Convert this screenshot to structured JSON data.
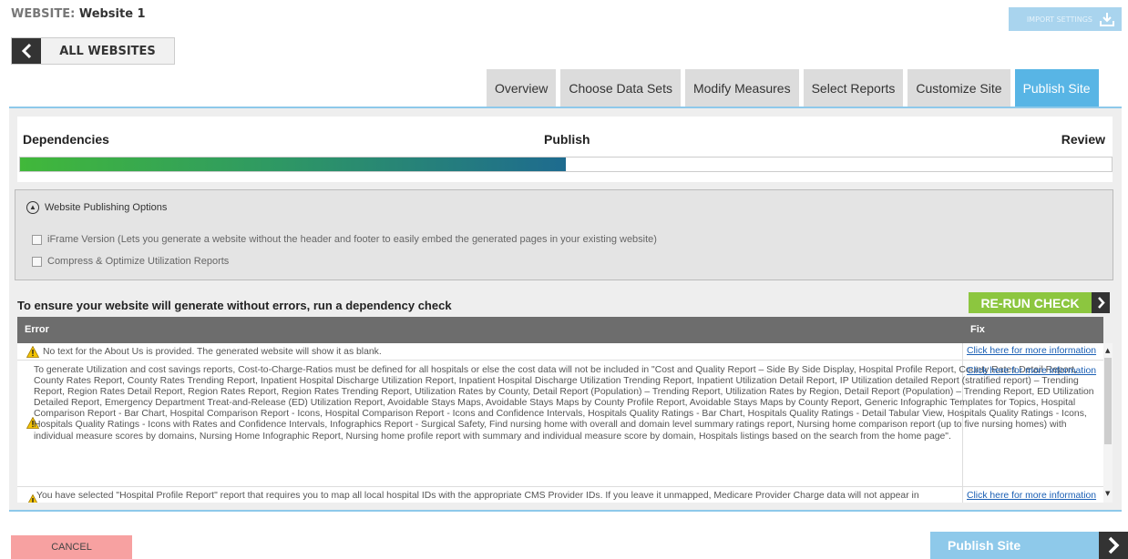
{
  "header": {
    "website_label": "WEBSITE:",
    "website_name": "Website 1",
    "import_label": "IMPORT SETTINGS",
    "back_label": "ALL WEBSITES"
  },
  "tabs": [
    {
      "label": "Overview",
      "active": false
    },
    {
      "label": "Choose Data Sets",
      "active": false
    },
    {
      "label": "Modify Measures",
      "active": false
    },
    {
      "label": "Select Reports",
      "active": false
    },
    {
      "label": "Customize Site",
      "active": false
    },
    {
      "label": "Publish Site",
      "active": true
    }
  ],
  "progress": {
    "steps": [
      "Dependencies",
      "Publish",
      "Review"
    ],
    "fraction": 0.5
  },
  "options": {
    "header": "Website Publishing Options",
    "items": [
      {
        "label": "iFrame Version (Lets you generate a website without the header and footer to easily embed the generated pages in your existing website)",
        "checked": false
      },
      {
        "label": "Compress & Optimize Utilization Reports",
        "checked": false
      }
    ]
  },
  "dependency": {
    "title": "To ensure your website will generate without errors, run a dependency check",
    "rerun_label": "RE-RUN CHECK",
    "col_error": "Error",
    "col_fix": "Fix",
    "rows": [
      {
        "error": "No text for the About Us is provided. The generated website will show it as blank.",
        "fix": "Click here for more information"
      },
      {
        "error": "To generate Utilization and cost savings reports, Cost-to-Charge-Ratios must be defined for all hospitals or else the cost data will not be included in \"Cost and Quality Report – Side By Side Display, Hospital Profile Report, County Rates Detail Report, County Rates Report, County Rates Trending Report, Inpatient Hospital Discharge Utilization Report, Inpatient Hospital Discharge Utilization Trending Report, Inpatient Utilization Detail Report, IP Utilization detailed Report (stratified report) – Trending Report, Region Rates Detail Report, Region Rates Report, Region Rates Trending Report, Utilization Rates by County, Detail Report (Population) – Trending Report, Utilization Rates by Region, Detail Report (Population) – Trending Report, ED Utilization Detailed Report, Emergency Department Treat-and-Release (ED) Utilization Report, Avoidable Stays Maps, Avoidable Stays Maps by County Profile Report, Avoidable Stays Maps by County Report, Generic Infographic Templates for Topics, Hospital Comparison Report - Bar Chart, Hospital Comparison Report - Icons, Hospital Comparison Report - Icons and Confidence Intervals, Hospitals Quality Ratings - Bar Chart, Hospitals Quality Ratings - Detail Tabular View, Hospitals Quality Ratings - Icons, Hospitals Quality Ratings - Icons with Rates and Confidence Intervals, Infographics Report -  Surgical Safety, Find nursing home with overall and domain level summary ratings report, Nursing home comparison report (up to five nursing homes) with individual measure scores by domains, Nursing Home Infographic Report, Nursing home profile report with summary and individual measure score by domain, Hospitals listings based on the search from the home page\".",
        "fix": "Click here for more information"
      },
      {
        "error": "You have selected \"Hospital Profile Report\" report that requires you to map all local hospital IDs with the appropriate CMS Provider IDs. If you leave it unmapped, Medicare Provider Charge data will not appear in",
        "fix": "Click here for more information"
      }
    ]
  },
  "footer": {
    "cancel_label": "CANCEL",
    "publish_label": "Publish Site"
  }
}
